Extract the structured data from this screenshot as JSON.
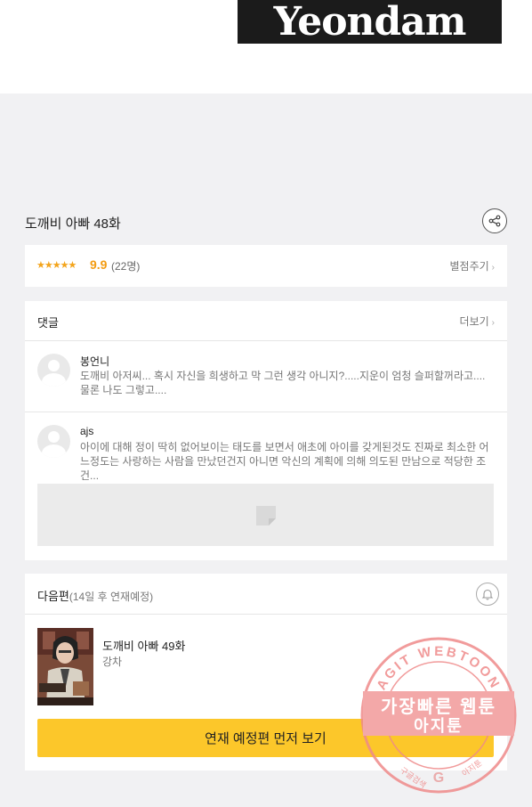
{
  "header": {
    "logo_text": "Yeondam"
  },
  "episode": {
    "title": "도깨비 아빠 48화"
  },
  "rating": {
    "stars": "★★★★★",
    "score": "9.9",
    "count": "(22명)",
    "rate_link": "별점주기"
  },
  "comments": {
    "title": "댓글",
    "more_label": "더보기",
    "items": [
      {
        "author": "봉언니",
        "text": "도깨비 아저씨... 혹시 자신을 희생하고 막 그런 생각 아니지?.....지운이 엄청 슬퍼할꺼라고.... 물론 나도 그렇고...."
      },
      {
        "author": "ajs",
        "text": "아이에 대해 정이 딱히 없어보이는 태도를 보면서 애초에 아이를 갖게된것도 진짜로 최소한 어느정도는 사랑하는 사람을 만났던건지 아니면 악신의 계획에 의해 의도된 만남으로 적당한 조건..."
      }
    ]
  },
  "next": {
    "title": "다음편",
    "schedule": "(14일 후 연재예정)",
    "episode_title": "도깨비 아빠 49화",
    "author": "강차",
    "cta_label": "연재 예정편 먼저 보기"
  },
  "watermark": {
    "ring_text": "AGIT WEBTOON",
    "line1": "가장빠른 웹툰",
    "line2": "아지툰",
    "bottom_left": "구글검색",
    "bottom_right": "아지툰"
  },
  "colors": {
    "accent_yellow": "#fcc72a",
    "star_orange": "#f39c12",
    "watermark_red": "#ef8a8a"
  }
}
